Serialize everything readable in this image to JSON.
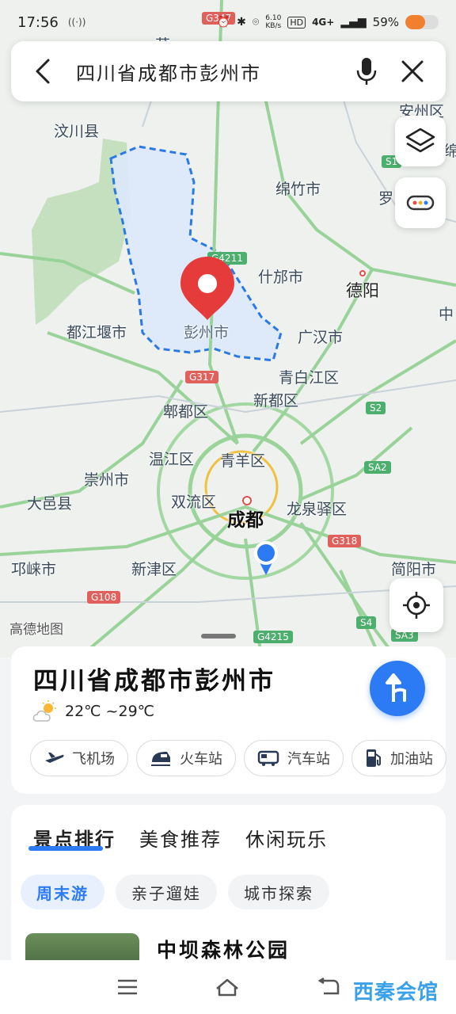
{
  "status_bar": {
    "time": "17:56",
    "network_speed": "6.10\nKB/s",
    "network": "4G+",
    "battery": "59%",
    "battery_level": 0.59
  },
  "search": {
    "query": "四川省成都市彭州市"
  },
  "map": {
    "labels": {
      "wenchuan": "汶川县",
      "mianzhu": "绵竹市",
      "shifang": "什邡市",
      "deyang": "德阳",
      "dujiangyan": "都江堰市",
      "pengzhou": "彭州市",
      "guanghan": "广汉市",
      "qingbaijiang": "青白江区",
      "xindu": "新都区",
      "pidu": "郫都区",
      "wenjiang": "温江区",
      "qingyang": "青羊区",
      "chongzhou": "崇州市",
      "dayi": "大邑县",
      "shuangliu": "双流区",
      "chengdu": "成都",
      "longquanyi": "龙泉驿区",
      "qionglai": "邛崃市",
      "xinjin": "新津区",
      "jianyang": "简阳市",
      "anzhou": "安州区",
      "mian": "绵",
      "luo": "罗",
      "zhong": "中",
      "yang": "阳",
      "fu": "阜",
      "partial_top": "茂"
    },
    "roads": {
      "g347": "G347",
      "s1": "S1",
      "g4211": "G4211",
      "g317": "G317",
      "s2": "S2",
      "sa2": "SA2",
      "g318": "G318",
      "g108": "G108",
      "g4215": "G4215",
      "s4": "S4",
      "sa3": "SA3"
    },
    "attribution": "高德地图"
  },
  "place_card": {
    "title": "四川省成都市彭州市",
    "weather": "22℃ ~29℃",
    "categories": [
      {
        "label": "飞机场",
        "icon": "airplane-icon"
      },
      {
        "label": "火车站",
        "icon": "train-icon"
      },
      {
        "label": "汽车站",
        "icon": "bus-icon"
      },
      {
        "label": "加油站",
        "icon": "gas-station-icon"
      }
    ]
  },
  "discover": {
    "tabs": [
      "景点排行",
      "美食推荐",
      "休闲玩乐"
    ],
    "subtabs": [
      "周末游",
      "亲子遛娃",
      "城市探索"
    ],
    "first_item": "中坝森林公园"
  },
  "watermark": "西秦会馆",
  "colors": {
    "accent": "#2d7bf4",
    "marker": "#e63b3b",
    "boundary": "#2a7ae2",
    "forest": "#c9e6c4"
  }
}
